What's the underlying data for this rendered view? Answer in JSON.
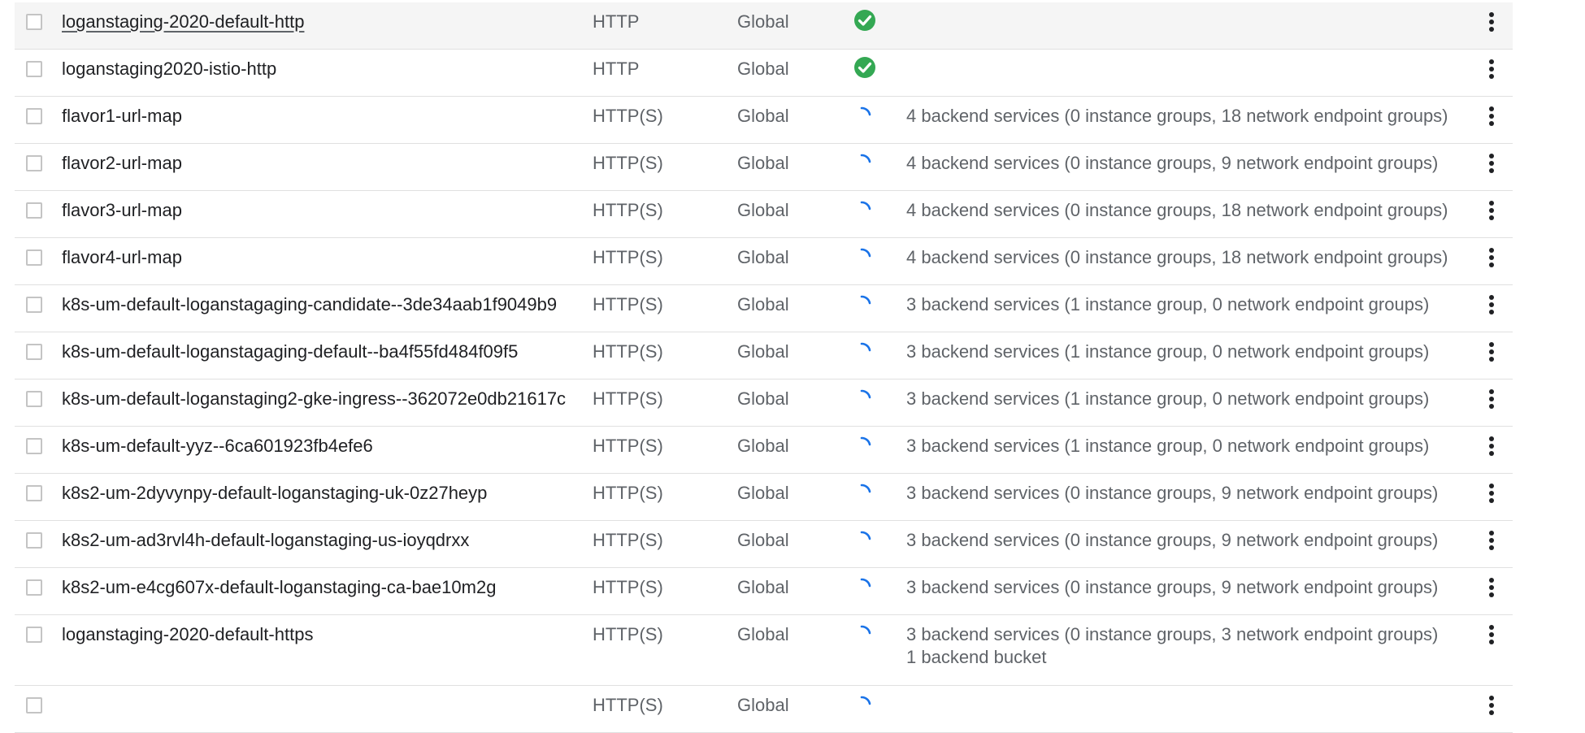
{
  "rows": [
    {
      "name": "loganstaging-2020-default-http",
      "protocol": "HTTP",
      "scope": "Global",
      "status": "ok",
      "backend": "",
      "backend2": "",
      "height": 57,
      "hover": true,
      "underline": true
    },
    {
      "name": "loganstaging2020-istio-http",
      "protocol": "HTTP",
      "scope": "Global",
      "status": "ok",
      "backend": "",
      "backend2": "",
      "height": 57
    },
    {
      "name": "flavor1-url-map",
      "protocol": "HTTP(S)",
      "scope": "Global",
      "status": "loading",
      "backend": "4 backend services (0 instance groups, 18 network endpoint groups)",
      "backend2": "",
      "height": 57
    },
    {
      "name": "flavor2-url-map",
      "protocol": "HTTP(S)",
      "scope": "Global",
      "status": "loading",
      "backend": "4 backend services (0 instance groups, 9 network endpoint groups)",
      "backend2": "",
      "height": 57
    },
    {
      "name": "flavor3-url-map",
      "protocol": "HTTP(S)",
      "scope": "Global",
      "status": "loading",
      "backend": "4 backend services (0 instance groups, 18 network endpoint groups)",
      "backend2": "",
      "height": 57
    },
    {
      "name": "flavor4-url-map",
      "protocol": "HTTP(S)",
      "scope": "Global",
      "status": "loading",
      "backend": "4 backend services (0 instance groups, 18 network endpoint groups)",
      "backend2": "",
      "height": 57
    },
    {
      "name": "k8s-um-default-loganstagaging-candidate--3de34aab1f9049b9",
      "protocol": "HTTP(S)",
      "scope": "Global",
      "status": "loading",
      "backend": "3 backend services (1 instance group, 0 network endpoint groups)",
      "backend2": "",
      "height": 57
    },
    {
      "name": "k8s-um-default-loganstagaging-default--ba4f55fd484f09f5",
      "protocol": "HTTP(S)",
      "scope": "Global",
      "status": "loading",
      "backend": "3 backend services (1 instance group, 0 network endpoint groups)",
      "backend2": "",
      "height": 57
    },
    {
      "name": "k8s-um-default-loganstaging2-gke-ingress--362072e0db21617c",
      "protocol": "HTTP(S)",
      "scope": "Global",
      "status": "loading",
      "backend": "3 backend services (1 instance group, 0 network endpoint groups)",
      "backend2": "",
      "height": 57
    },
    {
      "name": "k8s-um-default-yyz--6ca601923fb4efe6",
      "protocol": "HTTP(S)",
      "scope": "Global",
      "status": "loading",
      "backend": "3 backend services (1 instance group, 0 network endpoint groups)",
      "backend2": "",
      "height": 57
    },
    {
      "name": "k8s2-um-2dyvynpy-default-loganstaging-uk-0z27heyp",
      "protocol": "HTTP(S)",
      "scope": "Global",
      "status": "loading",
      "backend": "3 backend services (0 instance groups, 9 network endpoint groups)",
      "backend2": "",
      "height": 57
    },
    {
      "name": "k8s2-um-ad3rvl4h-default-loganstaging-us-ioyqdrxx",
      "protocol": "HTTP(S)",
      "scope": "Global",
      "status": "loading",
      "backend": "3 backend services (0 instance groups, 9 network endpoint groups)",
      "backend2": "",
      "height": 57
    },
    {
      "name": "k8s2-um-e4cg607x-default-loganstaging-ca-bae10m2g",
      "protocol": "HTTP(S)",
      "scope": "Global",
      "status": "loading",
      "backend": "3 backend services (0 instance groups, 9 network endpoint groups)",
      "backend2": "",
      "height": 57
    },
    {
      "name": "loganstaging-2020-default-https",
      "protocol": "HTTP(S)",
      "scope": "Global",
      "status": "loading",
      "backend": "3 backend services (0 instance groups, 3 network endpoint groups)",
      "backend2": "1 backend bucket",
      "height": 86
    },
    {
      "name": "",
      "protocol": "HTTP(S)",
      "scope": "Global",
      "status": "loading",
      "backend": "",
      "backend2": "",
      "height": 57
    }
  ],
  "colors": {
    "ok": "#34a853",
    "spinner": "#1a73e8"
  }
}
